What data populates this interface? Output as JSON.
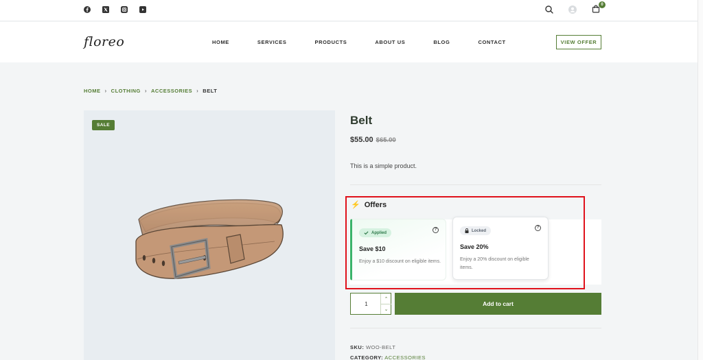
{
  "social": [
    {
      "icon": "facebook-icon"
    },
    {
      "icon": "x-twitter-icon"
    },
    {
      "icon": "instagram-icon"
    },
    {
      "icon": "youtube-icon"
    }
  ],
  "header_icons": {
    "search": "search-icon",
    "account": "user-avatar-icon",
    "cart": "shopping-bag-icon",
    "cart_count": "0"
  },
  "logo": "floreo",
  "nav": [
    "HOME",
    "SERVICES",
    "PRODUCTS",
    "ABOUT US",
    "BLOG",
    "CONTACT"
  ],
  "view_offer": "VIEW OFFER",
  "breadcrumb": {
    "items": [
      "HOME",
      "CLOTHING",
      "ACCESSORIES"
    ],
    "current": "BELT",
    "separator": "›"
  },
  "product": {
    "badge": "SALE",
    "title": "Belt",
    "price_now": "$55.00",
    "price_was": "$65.00",
    "short_description": "This is a simple product."
  },
  "offers": {
    "icon": "⚡",
    "title": "Offers",
    "cards": [
      {
        "status": "Applied",
        "title": "Save $10",
        "description": "Enjoy a $10 discount on eligible items.",
        "help": "?"
      },
      {
        "status": "Locked",
        "title": "Save 20%",
        "description": "Enjoy a 20% discount on eligible items.",
        "help": "?"
      }
    ]
  },
  "cart": {
    "quantity": "1",
    "add_label": "Add to cart",
    "up": "⌃",
    "down": "⌄"
  },
  "meta": {
    "sku_label": "SKU:",
    "sku_value": "WOO-BELT",
    "category_label": "CATEGORY:",
    "category_value": "ACCESSORIES"
  },
  "colors": {
    "brand": "#557d35",
    "highlight": "#e0101a",
    "applied": "#3ab36a",
    "offer_bolt": "#f2a20c"
  }
}
